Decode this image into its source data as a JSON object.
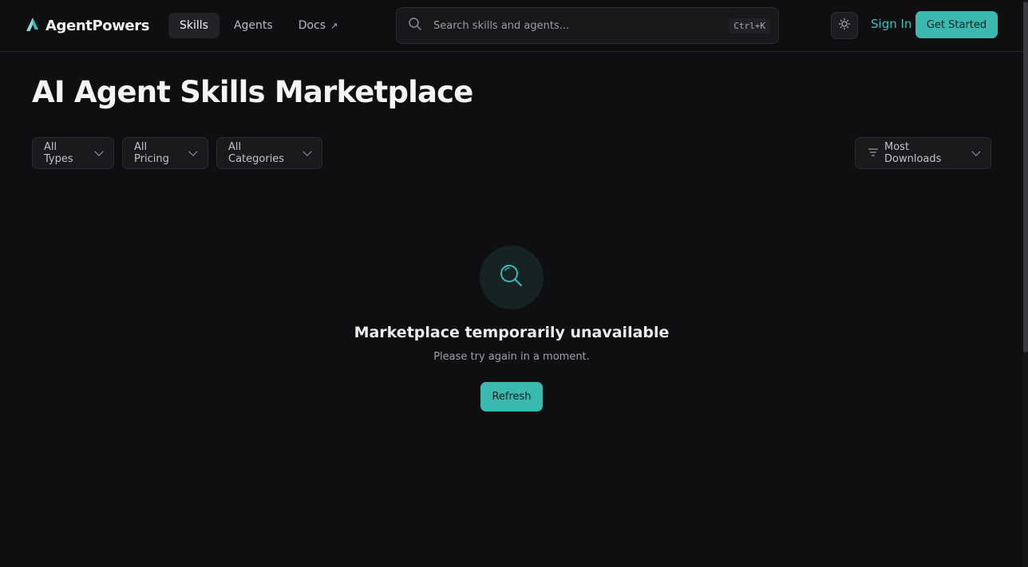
{
  "header": {
    "brand": "AgentPowers",
    "nav": [
      {
        "label": "Skills",
        "active": true
      },
      {
        "label": "Agents",
        "active": false
      },
      {
        "label": "Docs",
        "active": false,
        "external_icon": "arrow-up-right-icon",
        "external_glyph": "↗"
      }
    ],
    "search": {
      "placeholder": "Search skills and agents...",
      "value": "",
      "shortcut": "Ctrl+K"
    },
    "theme_toggle_icon": "sun-icon",
    "sign_in": "Sign In",
    "get_started": "Get Started"
  },
  "page": {
    "title": "AI Agent Skills Marketplace"
  },
  "filters": {
    "type": "All Types",
    "pricing": "All Pricing",
    "category": "All Categories",
    "sort": "Most Downloads"
  },
  "empty_state": {
    "icon": "search-icon",
    "title": "Marketplace temporarily unavailable",
    "message": "Please try again in a moment.",
    "action": "Refresh"
  },
  "colors": {
    "background": "#0f0f11",
    "accent": "#3bb9b0",
    "surface": "#1a1a1d"
  }
}
